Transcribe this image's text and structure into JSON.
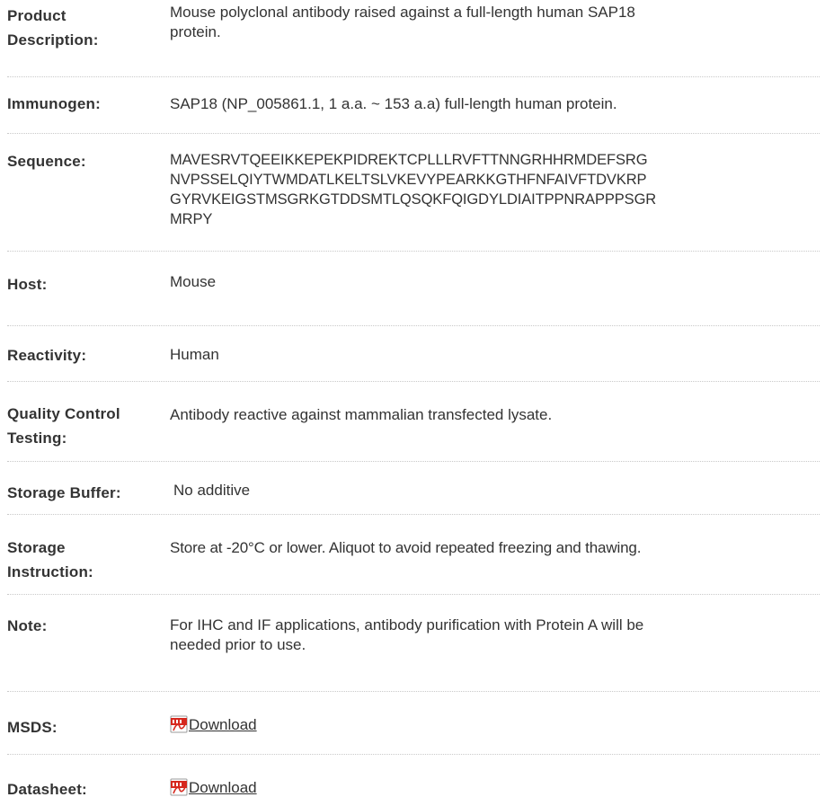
{
  "rows": [
    {
      "label": "Product Description:",
      "value": "Mouse polyclonal antibody raised against a full-length human SAP18\nprotein."
    },
    {
      "label": "Immunogen:",
      "value": "SAP18 (NP_005861.1, 1 a.a. ~ 153 a.a) full-length human protein."
    },
    {
      "label": "Sequence:",
      "value": "MAVESRVTQEEIKKEPEKPIDREKTCPLLLRVFTTNNGRHHRMDEFSRG\nNVPSSELQIYTWMDATLKELTSLVKEVYPEARKKGTHFNFAIVFTDVKRP\nGYRVKEIGSTMSGRKGTDDSMTLQSQKFQIGDYLDIAITPPNRAPPPSGR\nMRPY"
    },
    {
      "label": "Host:",
      "value": "Mouse"
    },
    {
      "label": "Reactivity:",
      "value": "Human"
    },
    {
      "label": "Quality Control Testing:",
      "value": "Antibody reactive against mammalian transfected lysate."
    },
    {
      "label": "Storage Buffer:",
      "value": "No additive"
    },
    {
      "label": "Storage Instruction:",
      "value": "Store at -20°C or lower. Aliquot to avoid repeated freezing and thawing."
    },
    {
      "label": "Note:",
      "value": "For IHC and IF applications, antibody purification with Protein A will be\nneeded prior to use."
    },
    {
      "label": "MSDS:",
      "link_text": "Download",
      "icon": "pdf-file-icon"
    },
    {
      "label": "Datasheet:",
      "link_text": "Download",
      "icon": "pdf-file-icon"
    }
  ],
  "label_lines": {
    "product_description": [
      "Product",
      "Description:"
    ],
    "quality_control": [
      "Quality Control",
      "Testing:"
    ],
    "storage_instruction": [
      "Storage",
      "Instruction:"
    ]
  },
  "colors": {
    "text": "#333333",
    "separator": "#c9c9c9",
    "pdf_icon_red": "#d6281e"
  }
}
